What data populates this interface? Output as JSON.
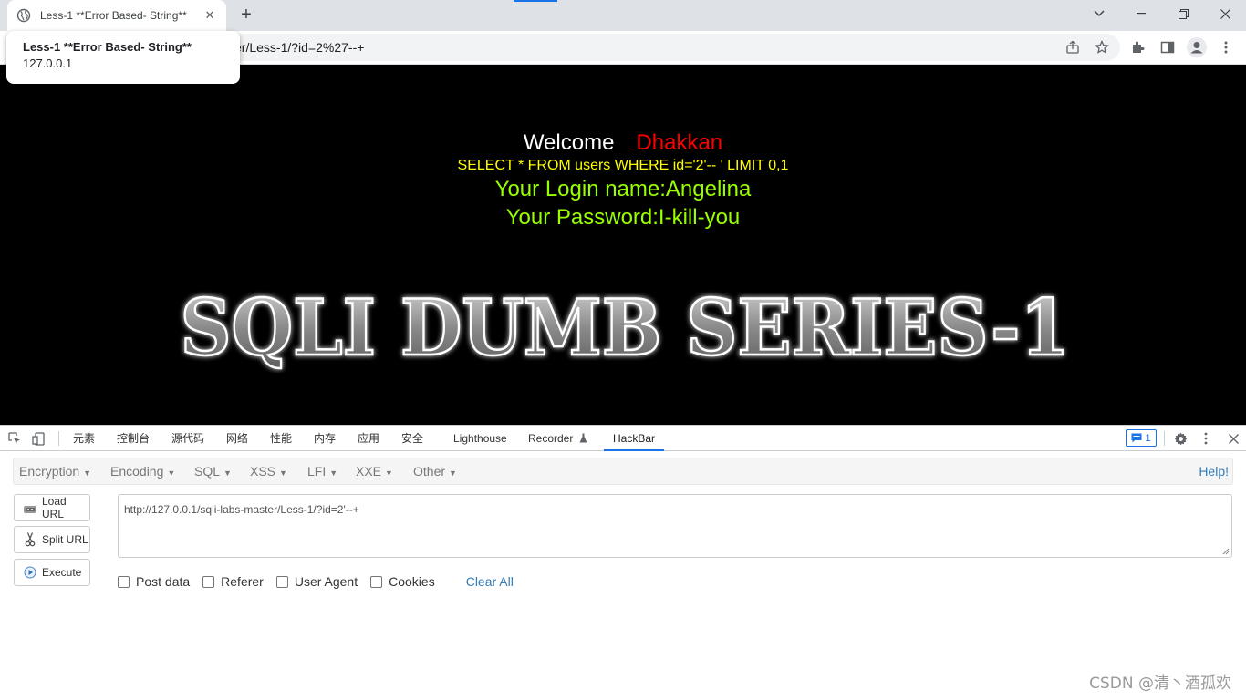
{
  "browser": {
    "tab_title": "Less-1 **Error Based- String**",
    "tab_close": "✕",
    "new_tab": "+",
    "url_visible": "-master/Less-1/?id=2%27--+",
    "tooltip_title": "Less-1 **Error Based- String**",
    "tooltip_host": "127.0.0.1"
  },
  "page": {
    "welcome": "Welcome",
    "name": "Dhakkan",
    "query": "SELECT * FROM users WHERE id='2'-- ' LIMIT 0,1",
    "login": "Your Login name:Angelina",
    "password": "Your Password:I-kill-you",
    "banner": "SQLI DUMB SERIES-1"
  },
  "devtools": {
    "tabs": [
      "元素",
      "控制台",
      "源代码",
      "网络",
      "性能",
      "内存",
      "应用",
      "安全",
      "Lighthouse",
      "Recorder",
      "HackBar"
    ],
    "issues_count": "1"
  },
  "hackbar": {
    "menu": [
      "Encryption",
      "Encoding",
      "SQL",
      "XSS",
      "LFI",
      "XXE",
      "Other"
    ],
    "help": "Help!",
    "load_url": "Load URL",
    "split_url": "Split URL",
    "execute": "Execute",
    "url_value": "http://127.0.0.1/sqli-labs-master/Less-1/?id=2'--+",
    "options": [
      "Post data",
      "Referer",
      "User Agent",
      "Cookies"
    ],
    "clear_all": "Clear All"
  },
  "watermark": "CSDN @清丶酒孤欢"
}
